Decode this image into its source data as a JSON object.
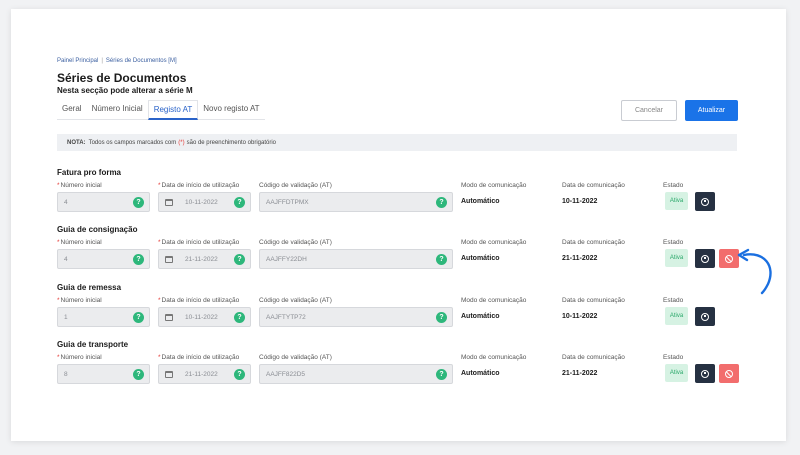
{
  "breadcrumb": {
    "home": "Painel Principal",
    "separator": "|",
    "current": "Séries de Documentos [M]"
  },
  "page": {
    "title": "Séries de Documentos",
    "subtitle": "Nesta secção pode alterar a série M"
  },
  "tabs": [
    {
      "label": "Geral",
      "active": false
    },
    {
      "label": "Número Inicial",
      "active": false
    },
    {
      "label": "Registo AT",
      "active": true
    },
    {
      "label": "Novo registo AT",
      "active": false
    }
  ],
  "actions": {
    "cancel": "Cancelar",
    "update": "Atualizar"
  },
  "note": {
    "label": "NOTA:",
    "text_before": "Todos os campos marcados com",
    "marker": "(*)",
    "text_after": "são de preenchimento obrigatório"
  },
  "labels": {
    "numero_inicial": "Número inicial",
    "data_inicio": "Data de início de utilização",
    "codigo": "Código de validação (AT)",
    "modo": "Modo de comunicação",
    "data_comunicacao": "Data de comunicação",
    "estado": "Estado",
    "required_star": "*",
    "help": "?"
  },
  "sections": [
    {
      "title": "Fatura pro forma",
      "numero_inicial": "4",
      "data_inicio": "10-11-2022",
      "codigo": "AAJFFDTPMX",
      "modo": "Automático",
      "data_comunicacao": "10-11-2022",
      "estado": "Ativa"
    },
    {
      "title": "Guia de consignação",
      "numero_inicial": "4",
      "data_inicio": "21-11-2022",
      "codigo": "AAJFFY22DH",
      "modo": "Automático",
      "data_comunicacao": "21-11-2022",
      "estado": "Ativa"
    },
    {
      "title": "Guia de remessa",
      "numero_inicial": "1",
      "data_inicio": "10-11-2022",
      "codigo": "AAJFTYTP72",
      "modo": "Automático",
      "data_comunicacao": "10-11-2022",
      "estado": "Ativa"
    },
    {
      "title": "Guia de transporte",
      "numero_inicial": "8",
      "data_inicio": "21-11-2022",
      "codigo": "AAJFF822D5",
      "modo": "Automático",
      "data_comunicacao": "21-11-2022",
      "estado": "Ativa"
    }
  ],
  "colors": {
    "accent": "#1a73e8",
    "help": "#2db77b",
    "status_bg": "#d6f2e3",
    "dark_btn": "#263142",
    "red_btn": "#f26d6d"
  }
}
